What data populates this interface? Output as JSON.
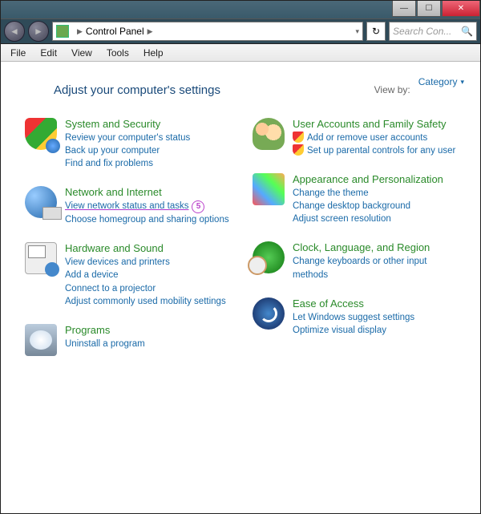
{
  "titlebar": {
    "min": "—",
    "max": "☐",
    "close": "✕"
  },
  "nav": {
    "back_glyph": "◄",
    "fwd_glyph": "►",
    "location": "Control Panel",
    "sep": "▶",
    "dropdown": "▾",
    "refresh": "↻"
  },
  "search": {
    "placeholder": "Search Con...",
    "icon": "🔍"
  },
  "menu": {
    "file": "File",
    "edit": "Edit",
    "view": "View",
    "tools": "Tools",
    "help": "Help"
  },
  "header": {
    "title": "Adjust your computer's settings",
    "viewby_label": "View by:",
    "viewby_value": "Category"
  },
  "annotation": {
    "number": "5"
  },
  "left": [
    {
      "title": "System and Security",
      "links": [
        "Review your computer's status",
        "Back up your computer",
        "Find and fix problems"
      ]
    },
    {
      "title": "Network and Internet",
      "links": [
        "View network status and tasks",
        "Choose homegroup and sharing options"
      ],
      "highlight_index": 0
    },
    {
      "title": "Hardware and Sound",
      "links": [
        "View devices and printers",
        "Add a device",
        "Connect to a projector",
        "Adjust commonly used mobility settings"
      ]
    },
    {
      "title": "Programs",
      "links": [
        "Uninstall a program"
      ]
    }
  ],
  "right": [
    {
      "title": "User Accounts and Family Safety",
      "sublinks": [
        "Add or remove user accounts",
        "Set up parental controls for any user"
      ]
    },
    {
      "title": "Appearance and Personalization",
      "links": [
        "Change the theme",
        "Change desktop background",
        "Adjust screen resolution"
      ]
    },
    {
      "title": "Clock, Language, and Region",
      "links": [
        "Change keyboards or other input methods"
      ]
    },
    {
      "title": "Ease of Access",
      "links": [
        "Let Windows suggest settings",
        "Optimize visual display"
      ]
    }
  ]
}
